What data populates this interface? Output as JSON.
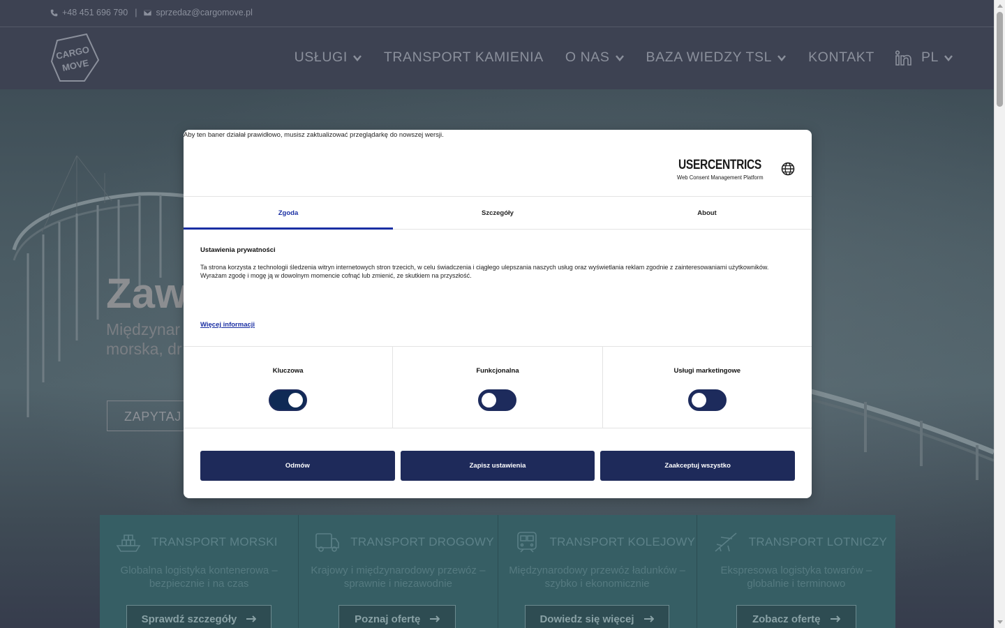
{
  "topbar": {
    "phone": "+48 451 696 790",
    "separator": "|",
    "email": "sprzedaz@cargomove.pl"
  },
  "header": {
    "logo_text_line1": "CARGO",
    "logo_text_line2": "MOVE",
    "nav": {
      "uslugi": "USŁUGI",
      "transport_kamienia": "TRANSPORT KAMIENIA",
      "o_nas": "O NAS",
      "baza_wiedzy": "BAZA WIEDZY TSL",
      "kontakt": "KONTAKT",
      "language": "PL"
    }
  },
  "hero": {
    "title": "Zaw",
    "subtitle_line1": "Międzynar",
    "subtitle_line2": "morska, dr",
    "cta": "ZAPYTAJ O"
  },
  "cards": [
    {
      "title": "TRANSPORT MORSKI",
      "description": "Globalna logistyka kontenerowa – bezpiecznie i na czas",
      "button": "Sprawdź szczegóły"
    },
    {
      "title": "TRANSPORT DROGOWY",
      "description": "Krajowy i międzynarodowy przewóz – sprawnie i niezawodnie",
      "button": "Poznaj ofertę"
    },
    {
      "title": "TRANSPORT KOLEJOWY",
      "description": "Międzynarodowy przewóz ładunków – szybko i ekonomicznie",
      "button": "Dowiedz się więcej"
    },
    {
      "title": "TRANSPORT LOTNICZY",
      "description": "Ekspresowa logistyka towarów – globalnie i terminowo",
      "button": "Zobacz ofertę"
    }
  ],
  "consent": {
    "browser_warning": "Aby ten baner działał prawidłowo, musisz zaktualizować przeglądarkę do nowszej wersji.",
    "brand_name": "USERCENTRICS",
    "brand_tagline": "Web Consent Management Platform",
    "tabs": [
      "Zgoda",
      "Szczegóły",
      "About"
    ],
    "heading": "Ustawienia prywatności",
    "body": "Ta strona korzysta z technologii śledzenia witryn internetowych stron trzecich, w celu świadczenia i ciągłego ulepszania naszych usług oraz wyświetlania reklam zgodnie z zainteresowaniami użytkowników. Wyrażam zgodę i mogę ją w dowolnym momencie cofnąć lub zmienić, ze skutkiem na przyszłość.",
    "more_info": "Więcej informacji",
    "categories": [
      {
        "label": "Kluczowa",
        "enabled": true
      },
      {
        "label": "Funkcjonalna",
        "enabled": false
      },
      {
        "label": "Usługi marketingowe",
        "enabled": false
      }
    ],
    "buttons": {
      "deny": "Odmów",
      "save": "Zapisz ustawienia",
      "accept_all": "Zaakceptuj wszystko"
    },
    "colors": {
      "primary": "#1e2a5a",
      "link": "#1a2fa3"
    }
  }
}
